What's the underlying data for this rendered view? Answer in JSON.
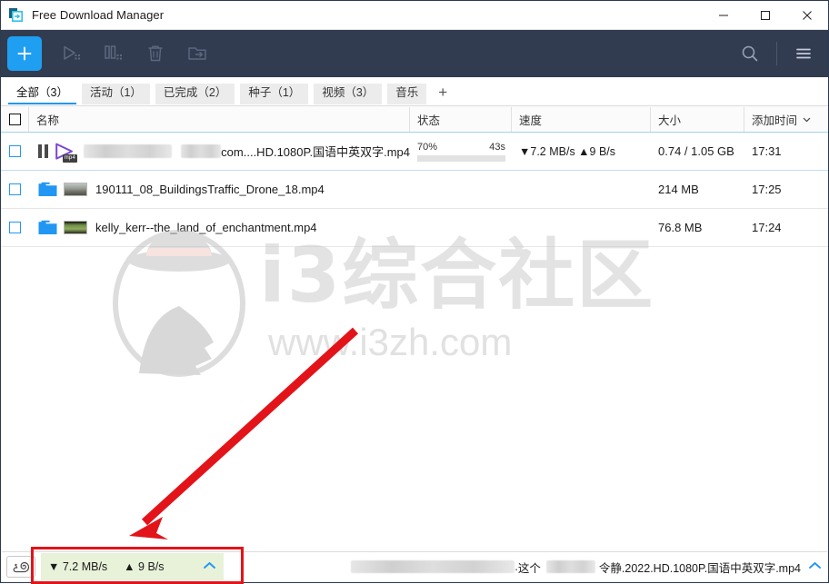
{
  "window": {
    "title": "Free Download Manager",
    "icon": "fdm-app-icon",
    "controls": [
      {
        "name": "minimize",
        "glyph": "minimize-icon"
      },
      {
        "name": "maximize",
        "glyph": "maximize-icon"
      },
      {
        "name": "close",
        "glyph": "close-icon"
      }
    ]
  },
  "toolbar": {
    "add_label": "+",
    "buttons": [
      {
        "name": "add-download-button",
        "icon": "plus-icon",
        "enabled": true
      },
      {
        "name": "resume-button",
        "icon": "play-icon",
        "enabled": false
      },
      {
        "name": "pause-button",
        "icon": "pause-icon",
        "enabled": false
      },
      {
        "name": "delete-button",
        "icon": "trash-icon",
        "enabled": false
      },
      {
        "name": "move-to-folder-button",
        "icon": "folder-arrow-icon",
        "enabled": false
      }
    ],
    "search_icon": "search-icon",
    "menu_icon": "hamburger-menu-icon",
    "background": "#323c50",
    "accent": "#1e9ff2"
  },
  "tabs": [
    {
      "label": "全部（3）",
      "active": true
    },
    {
      "label": "活动（1）",
      "active": false
    },
    {
      "label": "已完成（2）",
      "active": false
    },
    {
      "label": "种子（1）",
      "active": false
    },
    {
      "label": "视频（3）",
      "active": false
    },
    {
      "label": "音乐",
      "active": false
    },
    {
      "label": "+",
      "active": false
    }
  ],
  "table": {
    "columns": [
      "",
      "名称",
      "状态",
      "速度",
      "大小",
      "添加时间"
    ],
    "sort_column": "添加时间",
    "sort_icon": "chevron-down-icon",
    "rows": [
      {
        "checked": false,
        "status_icon": "pause-icon",
        "file_icon": "mp4-play-icon",
        "file_icon_badge": "mp4",
        "name_redacted": true,
        "name": "com....HD.1080P.国语中英双字.mp4",
        "progress_percent": "70%",
        "progress_value": 70,
        "eta": "43s",
        "speed": "▼7.2 MB/s ▲9 B/s",
        "size": "0.74 / 1.05 GB",
        "added": "17:31"
      },
      {
        "checked": false,
        "status_icon": "folder-icon",
        "file_icon": "video-thumbnail",
        "name_redacted": false,
        "name": "190111_08_BuildingsTraffic_Drone_18.mp4",
        "progress_percent": "",
        "eta": "",
        "speed": "",
        "size": "214 MB",
        "added": "17:25"
      },
      {
        "checked": false,
        "status_icon": "folder-icon",
        "file_icon": "video-thumbnail",
        "name_redacted": false,
        "name": "kelly_kerr--the_land_of_enchantment.mp4",
        "progress_percent": "",
        "eta": "",
        "speed": "",
        "size": "76.8 MB",
        "added": "17:24"
      }
    ]
  },
  "watermark": {
    "text": "i3综合社区",
    "url": "www.i3zh.com",
    "logo": "detective-avatar-logo"
  },
  "annotation": {
    "arrow_color": "#e3131a",
    "box_color": "#e3131a",
    "arrow": "red-arrow",
    "box_target": "speed-summary-panel"
  },
  "statusbar": {
    "limit_icon": "snail-speed-limit-icon",
    "download_speed": "▼ 7.2 MB/s",
    "upload_speed": "▲ 9 B/s",
    "expand_icon": "chevron-up-icon",
    "panel_color": "#e8f2d8",
    "current_file_part1": "这个",
    "current_file_part2": "令静.2022.HD.1080P.国语中英双字.mp4",
    "current_file_separator": ".",
    "expand_icon_right": "chevron-up-icon"
  }
}
